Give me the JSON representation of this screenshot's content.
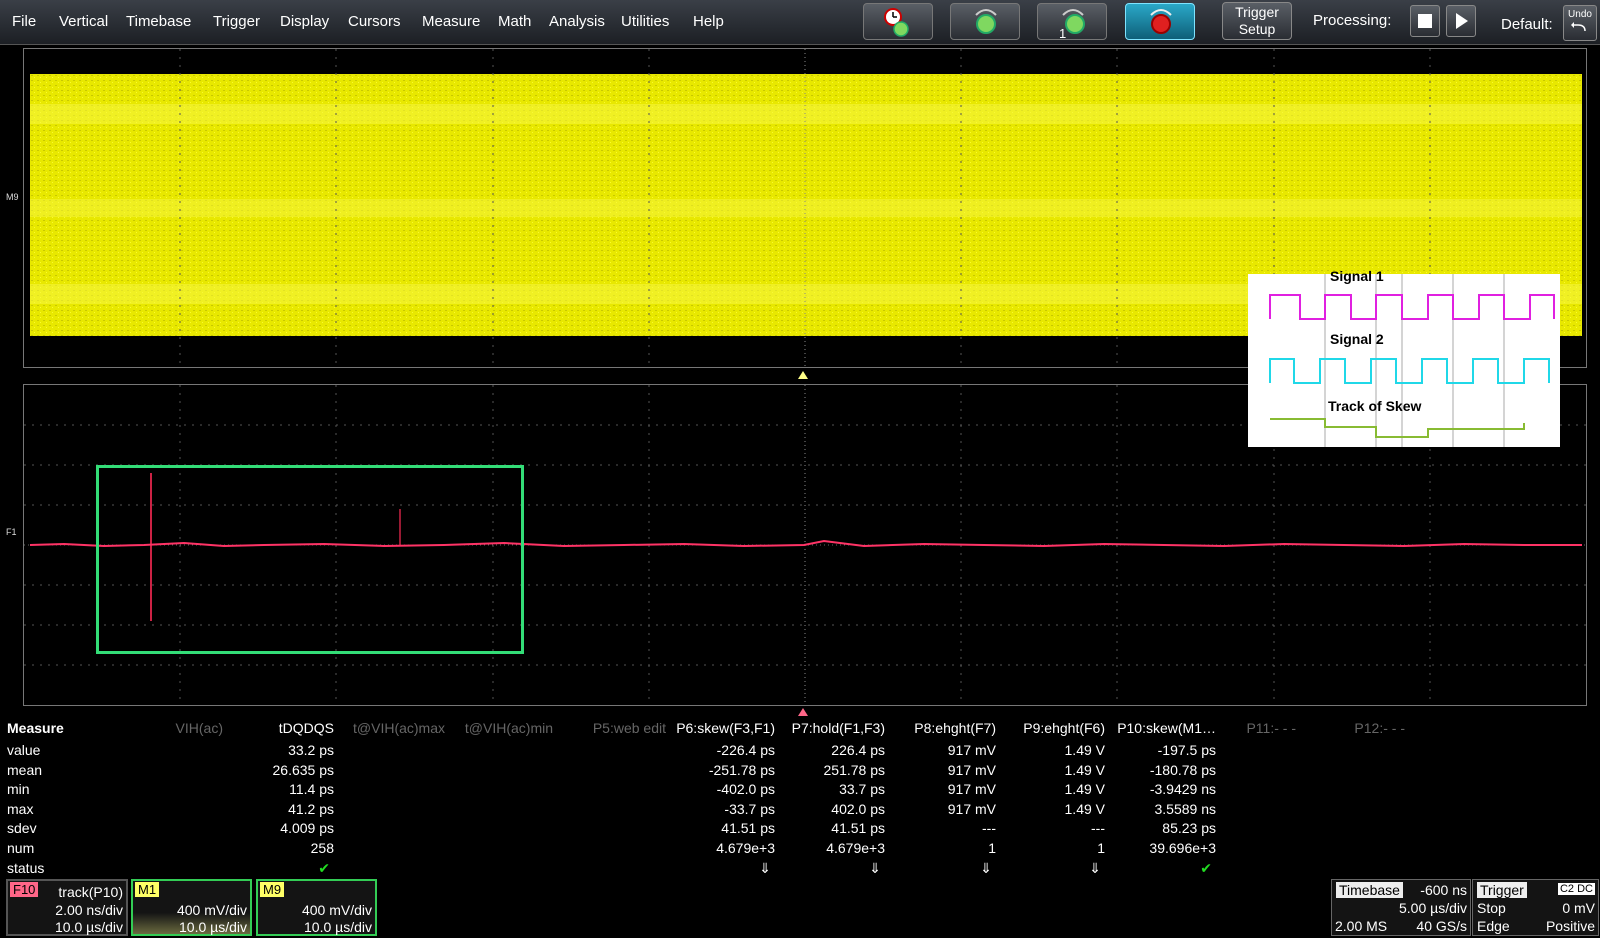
{
  "menu": [
    "File",
    "Vertical",
    "Timebase",
    "Trigger",
    "Display",
    "Cursors",
    "Measure",
    "Math",
    "Analysis",
    "Utilities",
    "Help"
  ],
  "toolbar": {
    "trigger_setup_line1": "Trigger",
    "trigger_setup_line2": "Setup",
    "processing_label": "Processing:",
    "default_label": "Default:",
    "undo_label": "Undo"
  },
  "traces": {
    "top_label": "M9",
    "bottom_label": "F1"
  },
  "inset": {
    "signal1": "Signal 1",
    "signal2": "Signal 2",
    "track": "Track of Skew",
    "colors": {
      "signal1": "#e020e0",
      "signal2": "#20d8e8",
      "track": "#88bb33"
    }
  },
  "measure": {
    "title": "Measure",
    "row_labels": [
      "value",
      "mean",
      "min",
      "max",
      "sdev",
      "num",
      "status"
    ],
    "columns": [
      {
        "header": "VIH(ac)",
        "dim": true,
        "values": [
          "",
          "",
          "",
          "",
          "",
          "",
          ""
        ]
      },
      {
        "header": "tDQDQS",
        "dim": false,
        "values": [
          "33.2 ps",
          "26.635 ps",
          "11.4 ps",
          "41.2 ps",
          "4.009 ps",
          "258",
          "✔"
        ]
      },
      {
        "header": "t@VIH(ac)max",
        "dim": true,
        "values": [
          "",
          "",
          "",
          "",
          "",
          "",
          ""
        ]
      },
      {
        "header": "t@VIH(ac)min",
        "dim": true,
        "values": [
          "",
          "",
          "",
          "",
          "",
          "",
          ""
        ]
      },
      {
        "header": "P5:web edit",
        "dim": true,
        "values": [
          "",
          "",
          "",
          "",
          "",
          "",
          ""
        ]
      },
      {
        "header": "P6:skew(F3,F1)",
        "dim": false,
        "values": [
          "-226.4 ps",
          "-251.78 ps",
          "-402.0 ps",
          "-33.7 ps",
          "41.51 ps",
          "4.679e+3",
          "⇓"
        ]
      },
      {
        "header": "P7:hold(F1,F3)",
        "dim": false,
        "values": [
          "226.4 ps",
          "251.78 ps",
          "33.7 ps",
          "402.0 ps",
          "41.51 ps",
          "4.679e+3",
          "⇓"
        ]
      },
      {
        "header": "P8:ehght(F7)",
        "dim": false,
        "values": [
          "917 mV",
          "917 mV",
          "917 mV",
          "917 mV",
          "---",
          "1",
          "⇓"
        ]
      },
      {
        "header": "P9:ehght(F6)",
        "dim": false,
        "values": [
          "1.49 V",
          "1.49 V",
          "1.49 V",
          "1.49 V",
          "---",
          "1",
          "⇓"
        ]
      },
      {
        "header": "P10:skew(M1…",
        "dim": false,
        "values": [
          "-197.5 ps",
          "-180.78 ps",
          "-3.9429 ns",
          "3.5589 ns",
          "85.23 ps",
          "39.696e+3",
          "✔"
        ]
      },
      {
        "header": "P11:- - -",
        "dim": true,
        "values": [
          "",
          "",
          "",
          "",
          "",
          "",
          ""
        ]
      },
      {
        "header": "P12:- - -",
        "dim": true,
        "values": [
          "",
          "",
          "",
          "",
          "",
          "",
          ""
        ]
      }
    ]
  },
  "descriptors": [
    {
      "tag": "F10",
      "name": "track(P10)",
      "line2": "2.00 ns/div",
      "line3": "10.0 µs/div",
      "tag_color": "#ff6688"
    },
    {
      "tag": "M1",
      "name": "",
      "line2": "400 mV/div",
      "line3": "10.0 µs/div",
      "tag_color": "#ffff66"
    },
    {
      "tag": "M9",
      "name": "",
      "line2": "400 mV/div",
      "line3": "10.0 µs/div",
      "tag_color": "#ffff66"
    }
  ],
  "timebase": {
    "label": "Timebase",
    "offset": "-600 ns",
    "div": "5.00 µs/div",
    "samples": "2.00 MS",
    "rate": "40 GS/s"
  },
  "trigger": {
    "label": "Trigger",
    "badge": "C2 DC",
    "mode": "Stop",
    "level": "0 mV",
    "type": "Edge",
    "slope": "Positive"
  }
}
